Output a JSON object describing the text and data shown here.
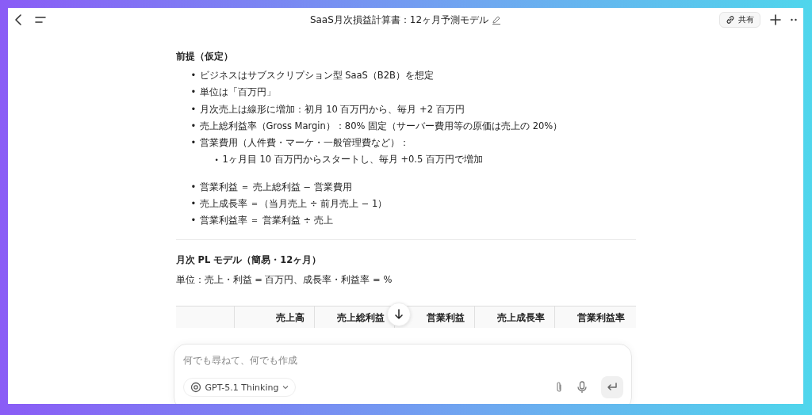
{
  "window": {
    "title": "SaaS月次損益計算書：12ヶ月予測モデル",
    "share_label": "共有"
  },
  "sections": [
    {
      "heading": "前提（仮定）",
      "lists": [
        [
          {
            "marker": "•",
            "text": "ビジネスはサブスクリプション型 SaaS（B2B）を想定"
          },
          {
            "marker": "•",
            "text": "単位は「百万円」"
          },
          {
            "marker": "•",
            "text": "月次売上は線形に増加：初月 10 百万円から、毎月 +2 百万円"
          },
          {
            "marker": "•",
            "text": "売上総利益率（Gross Margin）：80% 固定（サーバー費用等の原価は売上の 20%）"
          },
          {
            "marker": "•",
            "text": "営業費用（人件費・マーケ・一般管理費など）：",
            "children": [
              {
                "marker": "•",
                "text": "1ヶ月目 10 百万円からスタートし、毎月 +0.5 百万円で増加"
              }
            ]
          }
        ],
        [
          {
            "marker": "•",
            "text": "営業利益 ＝ 売上総利益 − 営業費用"
          },
          {
            "marker": "•",
            "text": "売上成長率 ＝（当月売上 ÷ 前月売上 − 1）"
          },
          {
            "marker": "•",
            "text": "営業利益率 ＝ 営業利益 ÷ 売上"
          }
        ]
      ]
    },
    {
      "heading": "月次 PL モデル（簡易・12ヶ月）",
      "note": "単位：売上・利益 = 百万円、成長率・利益率 = %",
      "table": {
        "columns": [
          "売上高",
          "売上総利益",
          "営業利益",
          "売上成長率",
          "営業利益率"
        ]
      }
    }
  ],
  "composer": {
    "placeholder": "何でも尋ねて、何でも作成",
    "model": "GPT-5.1 Thinking"
  }
}
